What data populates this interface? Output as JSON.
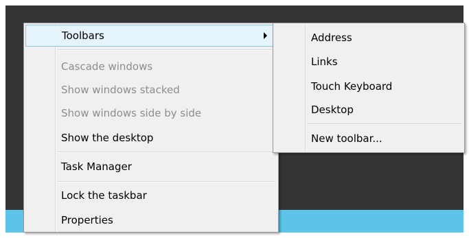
{
  "main_menu": {
    "items": [
      {
        "label": "Toolbars",
        "state": "highlighted",
        "has_submenu": true
      },
      {
        "label": "Cascade windows",
        "state": "disabled"
      },
      {
        "label": "Show windows stacked",
        "state": "disabled"
      },
      {
        "label": "Show windows side by side",
        "state": "disabled"
      },
      {
        "label": "Show the desktop",
        "state": "enabled"
      },
      {
        "label": "Task Manager",
        "state": "enabled"
      },
      {
        "label": "Lock the taskbar",
        "state": "enabled"
      },
      {
        "label": "Properties",
        "state": "enabled"
      }
    ]
  },
  "toolbars_submenu": {
    "items": [
      {
        "label": "Address"
      },
      {
        "label": "Links"
      },
      {
        "label": "Touch Keyboard"
      },
      {
        "label": "Desktop"
      },
      {
        "label": "New toolbar..."
      }
    ]
  },
  "colors": {
    "desktop_background": "#343434",
    "taskbar": "#5cc4e6",
    "menu_background": "#f0f0f0",
    "highlight_fill": "#e5f3fb",
    "highlight_border": "#8bc8ef",
    "disabled_text": "#8d8d8d"
  },
  "icons": {
    "submenu_arrow": "chevron-right-icon"
  }
}
